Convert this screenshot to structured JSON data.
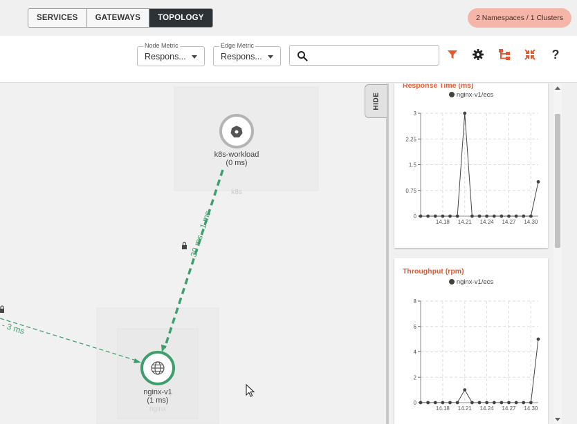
{
  "header": {
    "tabs": [
      {
        "label": "SERVICES",
        "active": false
      },
      {
        "label": "GATEWAYS",
        "active": false
      },
      {
        "label": "TOPOLOGY",
        "active": true
      }
    ],
    "namespace_badge": "2 Namespaces / 1 Clusters"
  },
  "toolbar": {
    "node_metric": {
      "legend": "Node Metric",
      "value": "Respons..."
    },
    "edge_metric": {
      "legend": "Edge Metric",
      "value": "Respons..."
    },
    "search_placeholder": "",
    "icons": [
      "filter-icon",
      "gear-icon",
      "hierarchy-icon",
      "collapse-icon",
      "help-icon"
    ],
    "help_label": "?",
    "accent_color": "#e5582e"
  },
  "graph": {
    "nodes": [
      {
        "name": "k8s-workload",
        "metric": "(0 ms)",
        "group_label": "k8s",
        "icon": "kubernetes-icon"
      },
      {
        "name": "nginx-v1",
        "metric": "(1 ms)",
        "group_label": "nginx",
        "icon": "globe-icon"
      }
    ],
    "edges": [
      {
        "label": "30 ms - 1 ms",
        "from": "k8s-workload",
        "to": "nginx-v1",
        "color": "#3f9f6c"
      },
      {
        "label": "- 3 ms",
        "to": "nginx-v1",
        "color": "#3f9f6c"
      }
    ],
    "hide_label": "HIDE"
  },
  "panel": {
    "charts": [
      {
        "title": "Response Time (ms)",
        "legend": "nginx-v1/ecs",
        "chart_data": {
          "type": "line",
          "title": "Response Time (ms)",
          "series": [
            {
              "name": "nginx-v1/ecs",
              "values": [
                0,
                0,
                0,
                0,
                0,
                0,
                3,
                0,
                0,
                0,
                0,
                0,
                0,
                0,
                0,
                0,
                1
              ]
            }
          ],
          "x_ticks": [
            "14.18",
            "14.21",
            "14.24",
            "14.27",
            "14.30"
          ],
          "y_ticks": [
            "0",
            "0.75",
            "1.5",
            "2.25",
            "3"
          ],
          "ylim": [
            0,
            3
          ],
          "grid": true
        }
      },
      {
        "title": "Throughput (rpm)",
        "legend": "nginx-v1/ecs",
        "chart_data": {
          "type": "line",
          "title": "Throughput (rpm)",
          "series": [
            {
              "name": "nginx-v1/ecs",
              "values": [
                0,
                0,
                0,
                0,
                0,
                0,
                1,
                0,
                0,
                0,
                0,
                0,
                0,
                0,
                0,
                0,
                5
              ]
            }
          ],
          "x_ticks": [
            "14.18",
            "14.21",
            "14.24",
            "14.27",
            "14.30"
          ],
          "y_ticks": [
            "0",
            "2",
            "4",
            "6",
            "8"
          ],
          "ylim": [
            0,
            8
          ],
          "grid": true
        }
      }
    ]
  }
}
